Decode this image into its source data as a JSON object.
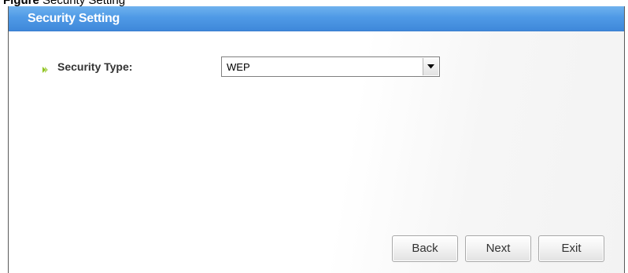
{
  "caption": {
    "prefix": "Figure",
    "rest": "   Security Setting"
  },
  "window": {
    "title": "Security Setting",
    "title_color": "#4f9ae6"
  },
  "form": {
    "security_type": {
      "label": "Security Type:",
      "selected": "WEP",
      "bullet_color": "#8fc31f",
      "arrow_icon": "chevron-down-icon"
    }
  },
  "buttons": {
    "back": "Back",
    "next": "Next",
    "exit": "Exit"
  }
}
